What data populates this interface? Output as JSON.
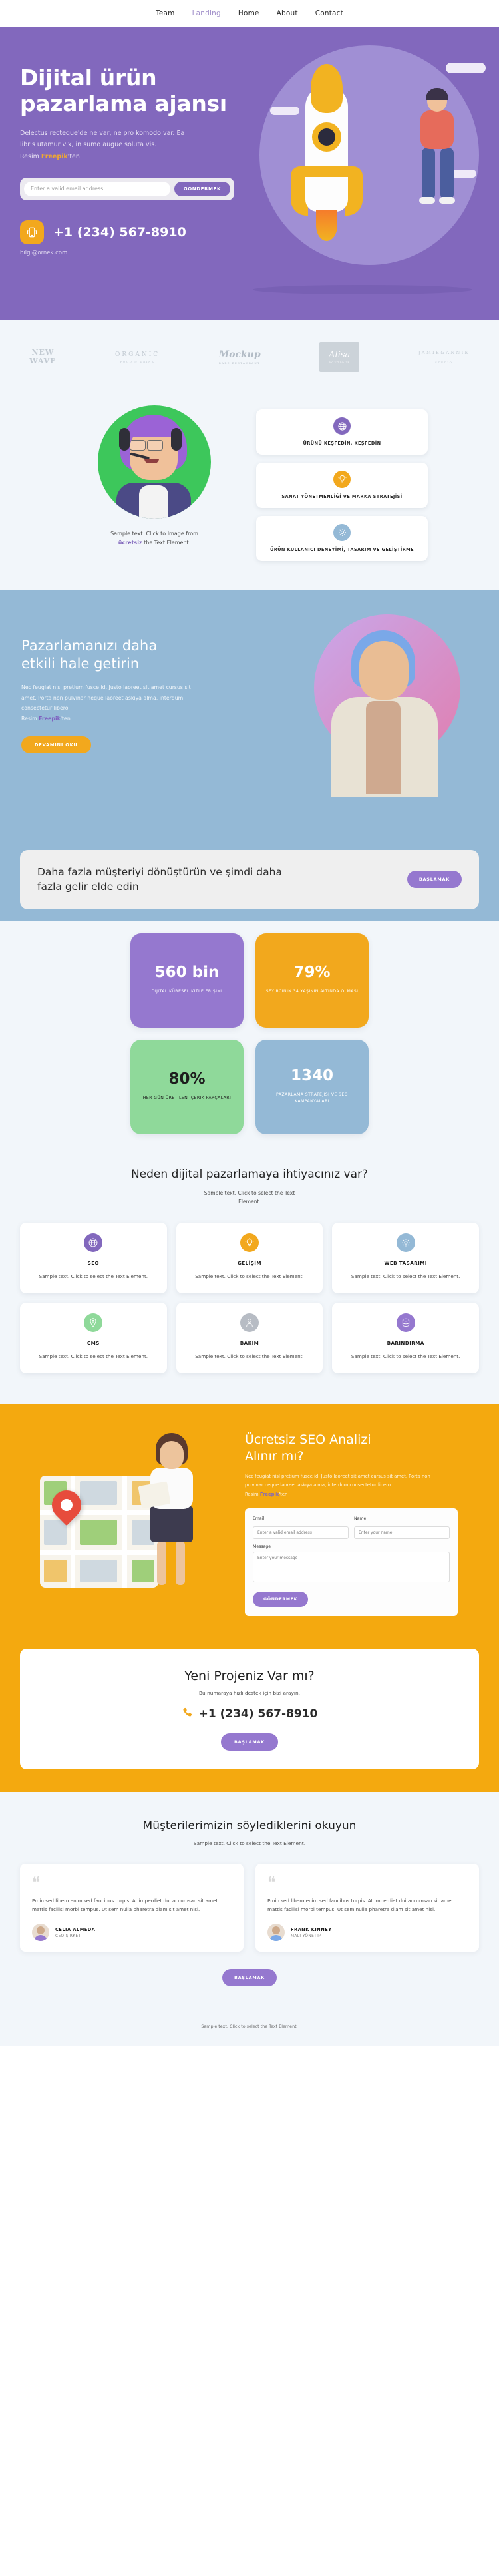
{
  "nav": {
    "items": [
      {
        "label": "Team",
        "active": false
      },
      {
        "label": "Landing",
        "active": true
      },
      {
        "label": "Home",
        "active": false
      },
      {
        "label": "About",
        "active": false
      },
      {
        "label": "Contact",
        "active": false
      }
    ]
  },
  "hero": {
    "title": "Dijital ürün pazarlama ajansı",
    "desc_line1": "Delectus recteque'de ne var, ne pro komodo var. Ea",
    "desc_line2": "libris utamur vix, in sumo augue soluta vis.",
    "credit_prefix": "Resim ",
    "credit_link": "Freepik",
    "credit_suffix": "'ten",
    "email_placeholder": "Enter a valid email address",
    "submit_label": "GÖNDERMEK",
    "phone": "+1 (234) 567-8910",
    "email": "bilgi@örnek.com"
  },
  "logos": [
    {
      "name": "NEW WAVE",
      "line1": "NEW",
      "line2": "WAVE"
    },
    {
      "name": "ORGANIC",
      "main": "ORGANIC",
      "sub": "FOOD & DRINK"
    },
    {
      "name": "Mockup",
      "main": "Mockup",
      "sub": "BARE RESTAURANT"
    },
    {
      "name": "Alisa",
      "main": "Alisa",
      "sub": "BOUTIQUE"
    },
    {
      "name": "JAMIE&ANNIE",
      "main": "JAMIE&ANNIE",
      "sub": "STUDIO"
    }
  ],
  "avatar_section": {
    "caption_line1": "Sample text. Click to Image from",
    "caption_link": "ücretsiz",
    "caption_line2": " the Text Element.",
    "cards": [
      {
        "label": "ÜRÜNÜ KEŞFEDİN, KEŞFEDİN",
        "icon": "globe-icon",
        "color": "#8268bd"
      },
      {
        "label": "SANAT YÖNETMENLİĞİ VE MARKA STRATEJİSİ",
        "icon": "lightbulb-icon",
        "color": "#f2a81d"
      },
      {
        "label": "ÜRÜN KULLANICI DENEYİMİ, TASARIM VE GELİŞTİRME",
        "icon": "gear-icon",
        "color": "#94b9d6"
      }
    ]
  },
  "blue_section": {
    "title": "Pazarlamanızı daha etkili hale getirin",
    "desc": "Nec feugiat nisl pretium fusce id. Justo laoreet sit amet cursus sit amet. Porta non pulvinar neque laoreet askıya alma, interdum consectetur libero.",
    "credit_prefix": "Resim ",
    "credit_link": "Freepik",
    "credit_suffix": "'ten",
    "button": "DEVAMINI OKU"
  },
  "cta_bar": {
    "title": "Daha fazla müşteriyi dönüştürün ve şimdi daha fazla gelir elde edin",
    "button": "BAŞLAMAK"
  },
  "stats": [
    {
      "value": "560 bin",
      "label": "DIJITAL KÜRESEL KITLE ERIŞIMI",
      "color": "#9578cf"
    },
    {
      "value": "79%",
      "label": "SEYIRCININ 34 YAŞININ ALTINDA OLMASI",
      "color": "#f2a81d"
    },
    {
      "value": "80%",
      "label": "HER GÜN ÜRETILEN IÇERIK PARÇALARI",
      "color": "#8fd99a"
    },
    {
      "value": "1340",
      "label": "PAZARLAMA STRATEJISI VE SEO KAMPANYALARI",
      "color": "#94b9d6"
    }
  ],
  "why_section": {
    "title": "Neden dijital pazarlamaya ihtiyacınız var?",
    "subtitle": "Sample text. Click to select the Text Element.",
    "cards": [
      {
        "title": "SEO",
        "text": "Sample text. Click to select the Text Element.",
        "icon": "globe-icon",
        "color": "#8268bd"
      },
      {
        "title": "GELİŞİM",
        "text": "Sample text. Click to select the Text Element.",
        "icon": "lightbulb-icon",
        "color": "#f2a81d"
      },
      {
        "title": "WEB TASARIMI",
        "text": "Sample text. Click to select the Text Element.",
        "icon": "gear-icon",
        "color": "#94b9d6"
      },
      {
        "title": "CMS",
        "text": "Sample text. Click to select the Text Element.",
        "icon": "location-pin-icon",
        "color": "#8fd99a"
      },
      {
        "title": "BAKIM",
        "text": "Sample text. Click to select the Text Element.",
        "icon": "user-icon",
        "color": "#b7bcc4"
      },
      {
        "title": "BARINDIRMA",
        "text": "Sample text. Click to select the Text Element.",
        "icon": "database-icon",
        "color": "#9578cf"
      }
    ]
  },
  "seo_section": {
    "title": "Ücretsiz SEO Analizi Alınır mı?",
    "desc": "Nec feugiat nisl pretium fusce id. Justo laoreet sit amet cursus sit amet. Porta non pulvinar neque laoreet askıya alma, interdum consectetur libero.",
    "credit_prefix": "Resim ",
    "credit_link": "Freepik",
    "credit_suffix": "'ten",
    "form": {
      "email_label": "Email",
      "email_placeholder": "Enter a valid email address",
      "name_label": "Name",
      "name_placeholder": "Enter your name",
      "message_label": "Message",
      "message_placeholder": "Enter your message",
      "submit_label": "GÖNDERMEK"
    }
  },
  "project_cta": {
    "title": "Yeni Projeniz Var mı?",
    "subtitle": "Bu numaraya hızlı destek için bizi arayın.",
    "phone": "+1 (234) 567-8910",
    "button": "BAŞLAMAK"
  },
  "testimonials": {
    "title": "Müşterilerimizin söylediklerini okuyun",
    "subtitle": "Sample text. Click to select the Text Element.",
    "quote_mark": "❝",
    "cards": [
      {
        "text": "Proin sed libero enim sed faucibus turpis. At imperdiet dui accumsan sit amet mattis facilisi morbi tempus. Ut sem nulla pharetra diam sit amet nisl.",
        "name": "CELIA ALMEDA",
        "role": "CEO ŞIRKET"
      },
      {
        "text": "Proin sed libero enim sed faucibus turpis. At imperdiet dui accumsan sit amet mattis facilisi morbi tempus. Ut sem nulla pharetra diam sit amet nisl.",
        "name": "FRANK KINNEY",
        "role": "MALI YÖNETIM"
      }
    ],
    "button": "BAŞLAMAK"
  },
  "footer": {
    "line": "Sample text. Click to select the Text Element."
  }
}
